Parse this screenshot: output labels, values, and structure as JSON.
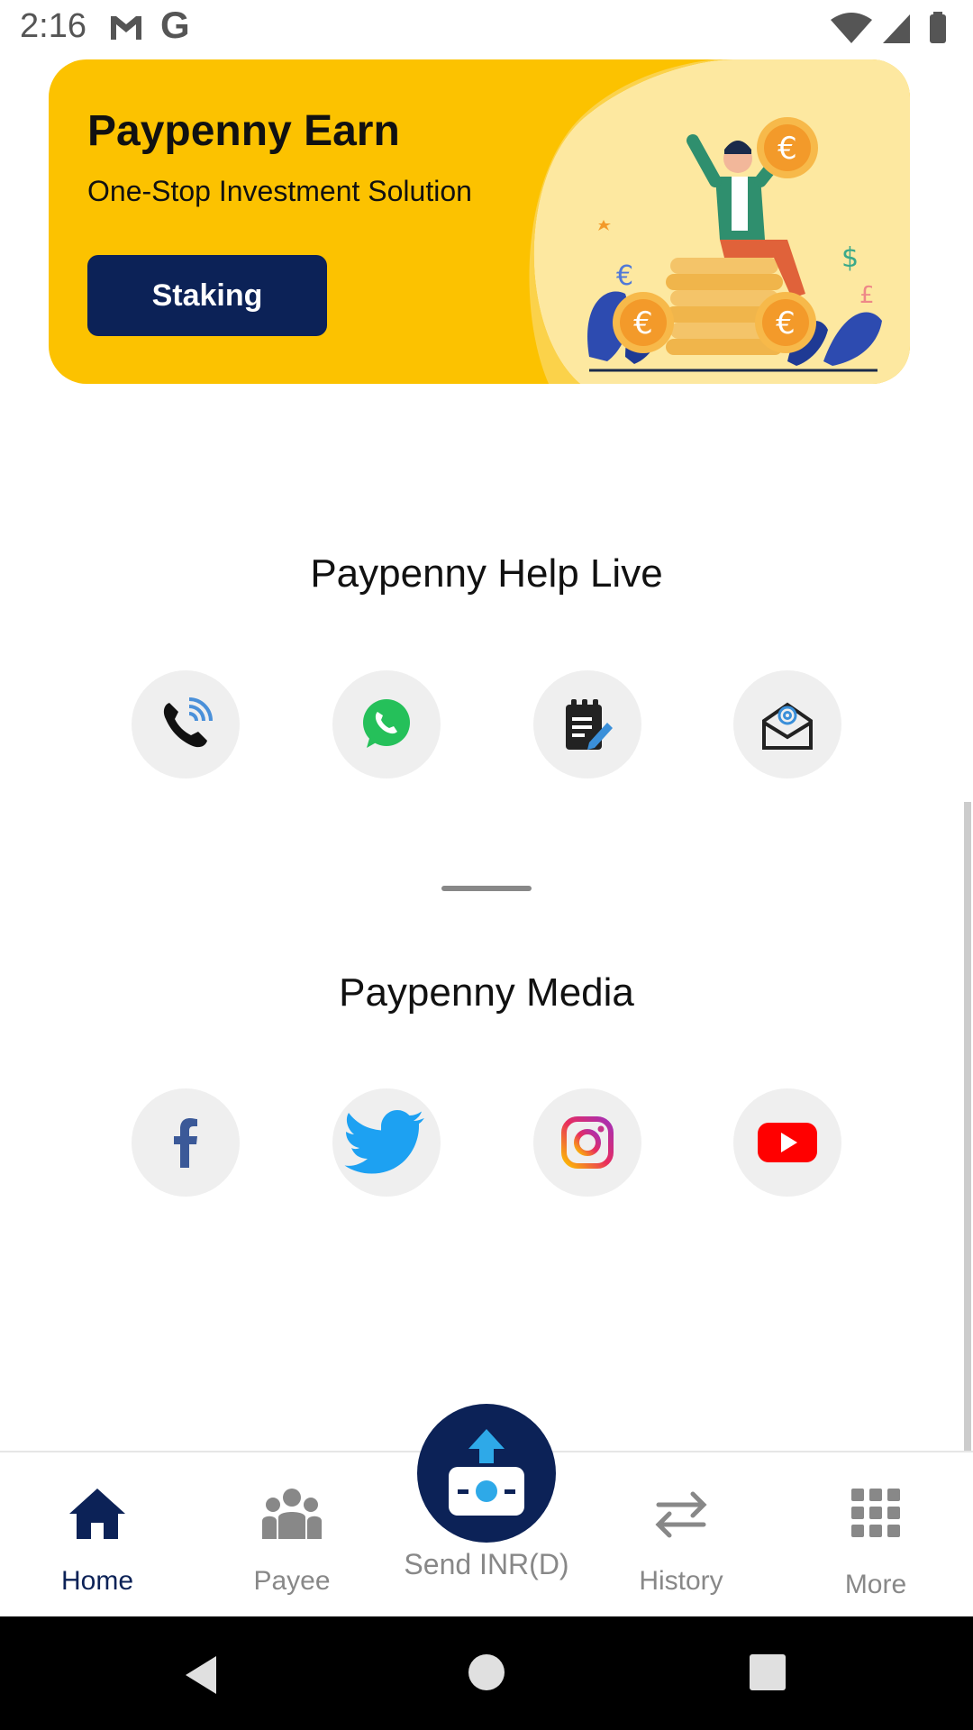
{
  "status_bar": {
    "time": "2:16"
  },
  "banner": {
    "title": "Paypenny Earn",
    "subtitle": "One-Stop Investment Solution",
    "button_label": "Staking"
  },
  "help": {
    "title": "Paypenny Help Live",
    "icons": [
      "phone-icon",
      "whatsapp-icon",
      "notes-icon",
      "email-icon"
    ]
  },
  "media": {
    "title": "Paypenny Media",
    "icons": [
      "facebook-icon",
      "twitter-icon",
      "instagram-icon",
      "youtube-icon"
    ]
  },
  "nav": {
    "home": "Home",
    "payee": "Payee",
    "send": "Send INR(D)",
    "history": "History",
    "more": "More"
  },
  "colors": {
    "brand_navy": "#0c2257",
    "banner_yellow": "#fcc200"
  }
}
